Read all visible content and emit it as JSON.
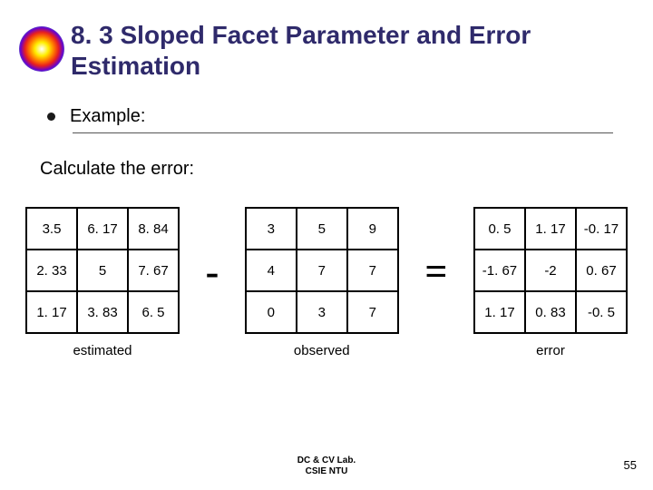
{
  "title": "8. 3 Sloped Facet Parameter and Error Estimation",
  "bullet": "Example:",
  "subtext": "Calculate the error:",
  "op_minus": "-",
  "op_equals": "=",
  "tables": {
    "estimated": {
      "caption": "estimated",
      "cells": [
        [
          "3.5",
          "6. 17",
          "8. 84"
        ],
        [
          "2. 33",
          "5",
          "7. 67"
        ],
        [
          "1. 17",
          "3. 83",
          "6. 5"
        ]
      ]
    },
    "observed": {
      "caption": "observed",
      "cells": [
        [
          "3",
          "5",
          "9"
        ],
        [
          "4",
          "7",
          "7"
        ],
        [
          "0",
          "3",
          "7"
        ]
      ]
    },
    "error": {
      "caption": "error",
      "cells": [
        [
          "0. 5",
          "1. 17",
          "-0. 17"
        ],
        [
          "-1. 67",
          "-2",
          "0. 67"
        ],
        [
          "1. 17",
          "0. 83",
          "-0. 5"
        ]
      ]
    }
  },
  "footer_line1": "DC & CV Lab.",
  "footer_line2": "CSIE NTU",
  "page_number": "55",
  "chart_data": [
    {
      "type": "table",
      "title": "estimated",
      "values": [
        [
          3.5,
          6.17,
          8.84
        ],
        [
          2.33,
          5,
          7.67
        ],
        [
          1.17,
          3.83,
          6.5
        ]
      ]
    },
    {
      "type": "table",
      "title": "observed",
      "values": [
        [
          3,
          5,
          9
        ],
        [
          4,
          7,
          7
        ],
        [
          0,
          3,
          7
        ]
      ]
    },
    {
      "type": "table",
      "title": "error",
      "values": [
        [
          0.5,
          1.17,
          -0.17
        ],
        [
          -1.67,
          -2,
          0.67
        ],
        [
          1.17,
          0.83,
          -0.5
        ]
      ]
    }
  ]
}
